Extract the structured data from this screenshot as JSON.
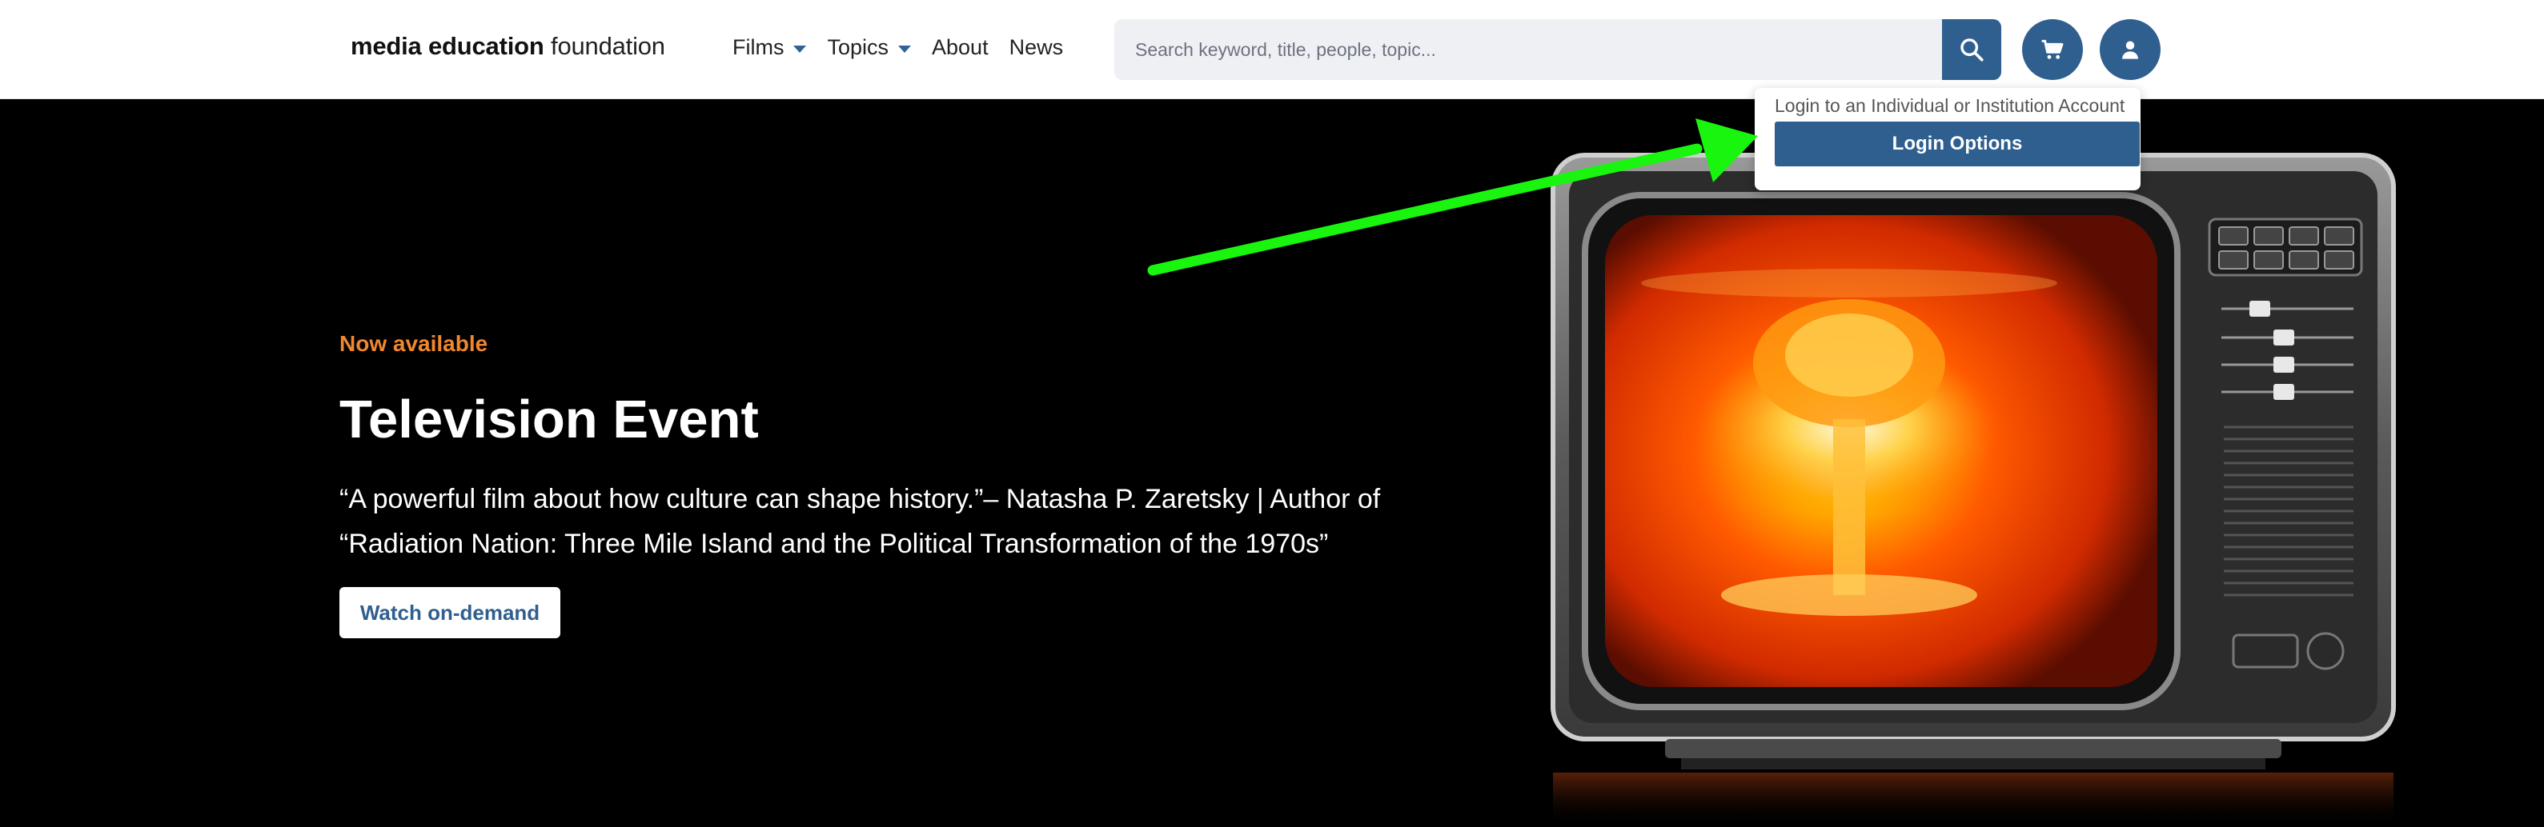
{
  "header": {
    "logo": {
      "bold": "media education",
      "light": " foundation"
    },
    "nav": [
      {
        "label": "Films",
        "has_dropdown": true
      },
      {
        "label": "Topics",
        "has_dropdown": true
      },
      {
        "label": "About",
        "has_dropdown": false
      },
      {
        "label": "News",
        "has_dropdown": false
      }
    ],
    "search": {
      "placeholder": "Search keyword, title, people, topic...",
      "value": ""
    },
    "icons": {
      "search": "search-icon",
      "cart": "cart-icon",
      "account": "user-icon"
    },
    "colors": {
      "accent": "#2f5f8f"
    }
  },
  "login_dropdown": {
    "message": "Login to an Individual or Institution Account",
    "button_label": "Login Options"
  },
  "hero": {
    "eyebrow": "Now available",
    "title": "Television Event",
    "quote": "“A powerful film about how culture can shape history.”– Natasha P. Zaretsky | Author of “Radiation Nation: Three Mile Island and the Political Transformation of the 1970s”",
    "cta_label": "Watch on-demand",
    "colors": {
      "eyebrow": "#f0872f",
      "background": "#000000"
    }
  }
}
